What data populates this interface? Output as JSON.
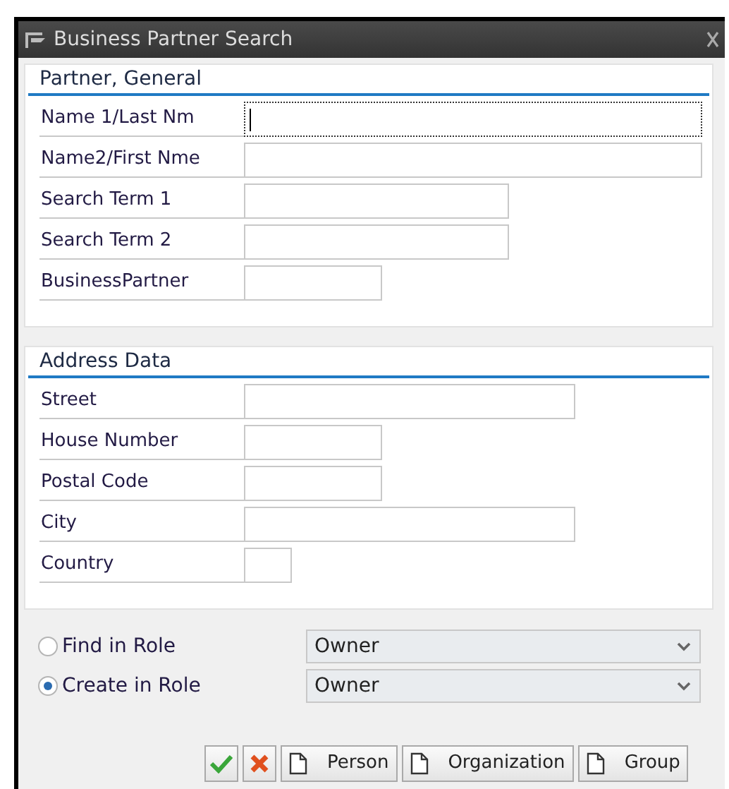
{
  "window": {
    "title": "Business Partner Search"
  },
  "groups": [
    {
      "title": "Partner, General",
      "fields": [
        {
          "label": "Name 1/Last Nm",
          "focused": true
        },
        {
          "label": "Name2/First Nme",
          "focused": false
        },
        {
          "label": "Search Term 1",
          "focused": false
        },
        {
          "label": "Search Term 2",
          "focused": false
        },
        {
          "label": "BusinessPartner",
          "focused": false
        }
      ]
    },
    {
      "title": "Address Data",
      "fields": [
        {
          "label": "Street",
          "focused": false
        },
        {
          "label": "House Number",
          "focused": false
        },
        {
          "label": "Postal Code",
          "focused": false
        },
        {
          "label": "City",
          "focused": false
        },
        {
          "label": "Country",
          "focused": false
        }
      ]
    }
  ],
  "roles": [
    {
      "label": "Find in Role",
      "selected": false,
      "value": "Owner"
    },
    {
      "label": "Create in Role",
      "selected": true,
      "value": "Owner"
    }
  ],
  "buttons": [
    {
      "kind": "confirm"
    },
    {
      "kind": "cancel"
    },
    {
      "kind": "new",
      "label": "Person"
    },
    {
      "kind": "new",
      "label": "Organization"
    },
    {
      "kind": "new",
      "label": "Group"
    }
  ]
}
